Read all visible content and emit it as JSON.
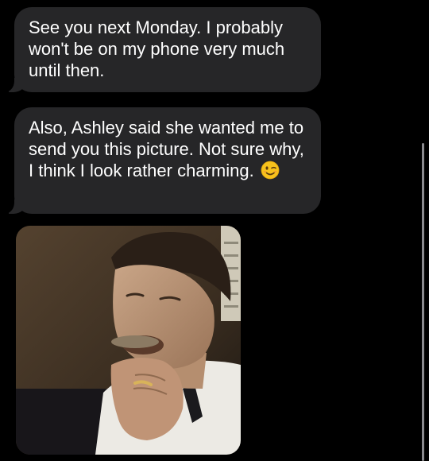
{
  "messages": [
    {
      "text": "See you next Monday. I probably won't be on my phone very much until then."
    },
    {
      "text": "Also, Ashley said she wanted me to send you this picture. Not sure why, I think I look rather charming.",
      "emoji": "winking-face-emoji"
    }
  ],
  "attachment": {
    "type": "photo",
    "icon": "photo-attachment"
  },
  "colors": {
    "background": "#000000",
    "incoming_bubble": "#262628",
    "text": "#ffffff",
    "scrollbar": "#8a8a8e"
  }
}
